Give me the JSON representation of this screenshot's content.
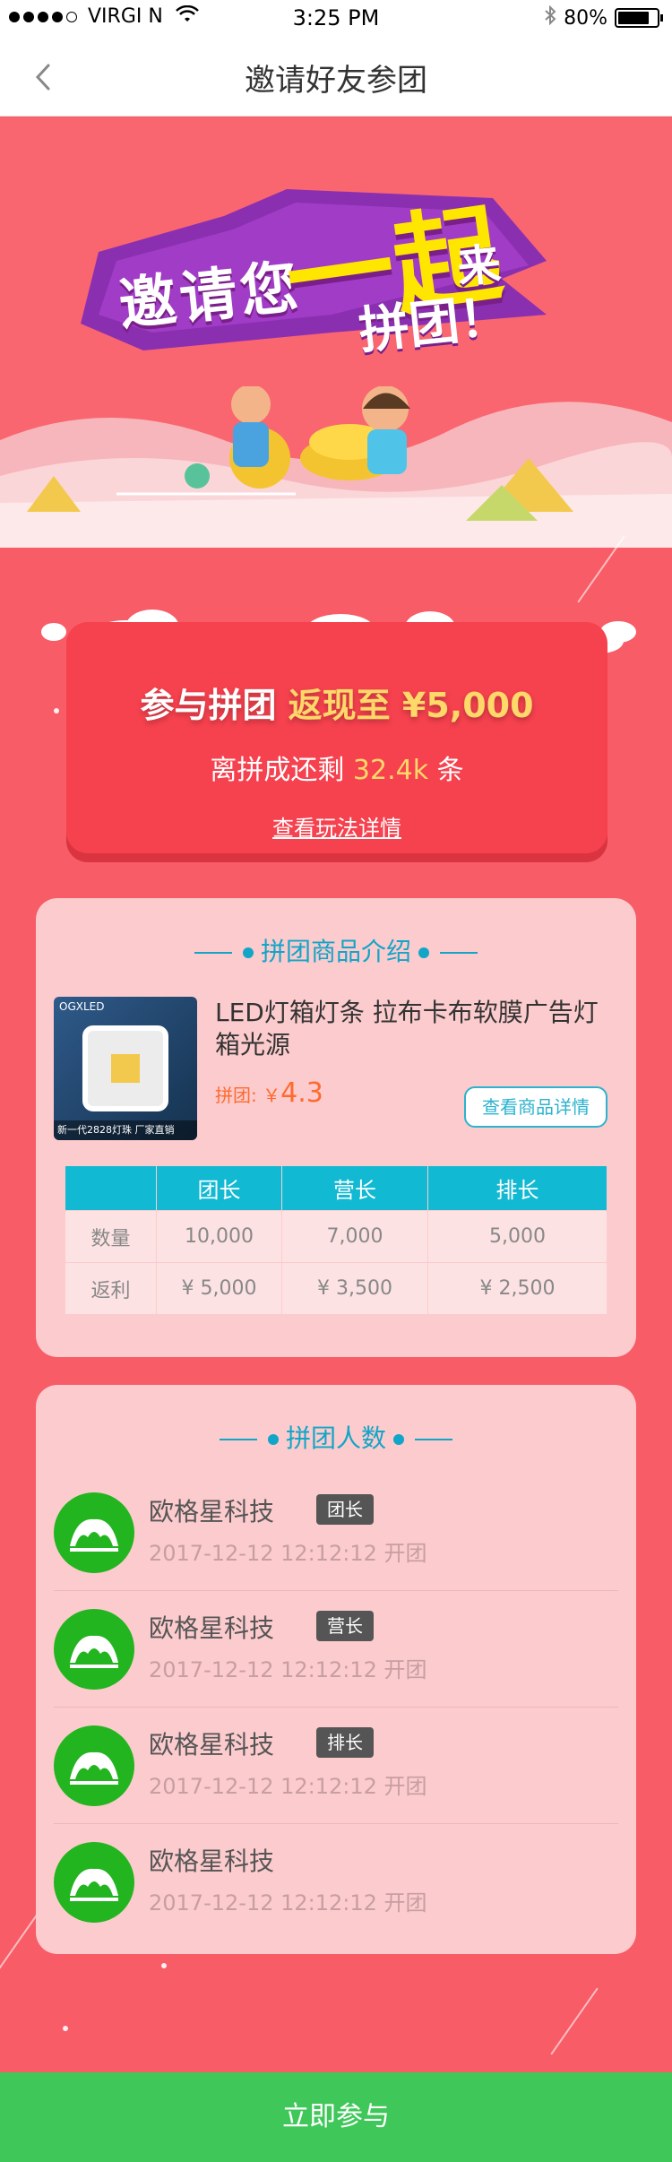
{
  "status_bar": {
    "carrier": "VIRGI N",
    "time": "3:25 PM",
    "battery_percent": "80%",
    "battery_level": 0.8,
    "signal_icon": "signal-dots-icon",
    "wifi_icon": "wifi-icon",
    "bluetooth_icon": "bluetooth-icon"
  },
  "nav": {
    "title": "邀请好友参团",
    "back_icon": "chevron-left-icon"
  },
  "hero": {
    "text_invite": "邀请您",
    "text_together": "一起",
    "text_come": "来",
    "text_group": "拼团！",
    "colors": {
      "banner": "#8b2fb1",
      "highlight": "#ffe600"
    }
  },
  "rebate": {
    "prefix": "参与拼团 ",
    "highlight": "返现至 ¥5,000",
    "remain_prefix": "离拼成还剩 ",
    "remain_count": "32.4k",
    "remain_suffix": " 条",
    "details_link": "查看玩法详情"
  },
  "goods": {
    "section_title": "拼团商品介绍",
    "thumb_brand": "OGXLED",
    "thumb_tag": "新一代2828灯珠  厂家直销",
    "title": "LED灯箱灯条 拉布卡布软膜广告灯箱光源",
    "price_label": "拼团: ￥",
    "price": "4.3",
    "details_button": "查看商品详情",
    "table": {
      "headers": [
        "",
        "团长",
        "营长",
        "排长"
      ],
      "rows": [
        [
          "数量",
          "10,000",
          "7,000",
          "5,000"
        ],
        [
          "返利",
          "¥ 5,000",
          "¥ 3,500",
          "¥ 2,500"
        ]
      ]
    }
  },
  "members": {
    "section_title": "拼团人数",
    "list": [
      {
        "name": "欧格星科技",
        "role": "团长",
        "time": "2017-12-12 12:12:12 开团"
      },
      {
        "name": "欧格星科技",
        "role": "营长",
        "time": "2017-12-12 12:12:12 开团"
      },
      {
        "name": "欧格星科技",
        "role": "排长",
        "time": "2017-12-12 12:12:12 开团"
      },
      {
        "name": "欧格星科技",
        "role": "",
        "time": "2017-12-12 12:12:12 开团"
      }
    ]
  },
  "footer": {
    "join_button": "立即参与"
  }
}
